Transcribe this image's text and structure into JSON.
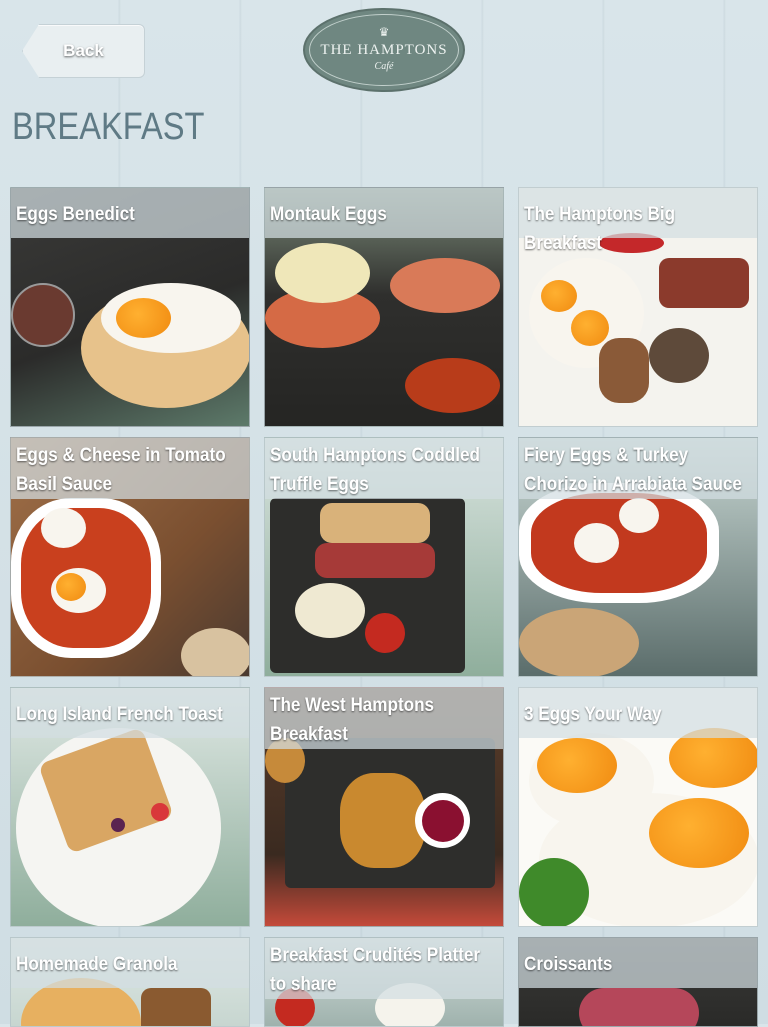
{
  "header": {
    "back_label": "Back",
    "logo_name": "THE HAMPTONS",
    "logo_sub": "Café"
  },
  "page_title": "BREAKFAST",
  "items": [
    {
      "label": "Eggs Benedict"
    },
    {
      "label": "Montauk Eggs"
    },
    {
      "label": "The Hamptons Big Breakfast"
    },
    {
      "label": "Eggs & Cheese in Tomato Basil Sauce"
    },
    {
      "label": "South Hamptons Coddled Truffle Eggs"
    },
    {
      "label": "Fiery Eggs & Turkey Chorizo in Arrabiata Sauce"
    },
    {
      "label": "Long Island French Toast"
    },
    {
      "label": "The West Hamptons Breakfast"
    },
    {
      "label": "3 Eggs Your Way"
    },
    {
      "label": "Homemade Granola"
    },
    {
      "label": "Breakfast Crudités Platter to share"
    },
    {
      "label": "Croissants"
    }
  ],
  "colors": {
    "title": "#5f7a85",
    "logo_bg": "#6f8781",
    "label_overlay": "rgba(210,222,226,0.72)"
  }
}
